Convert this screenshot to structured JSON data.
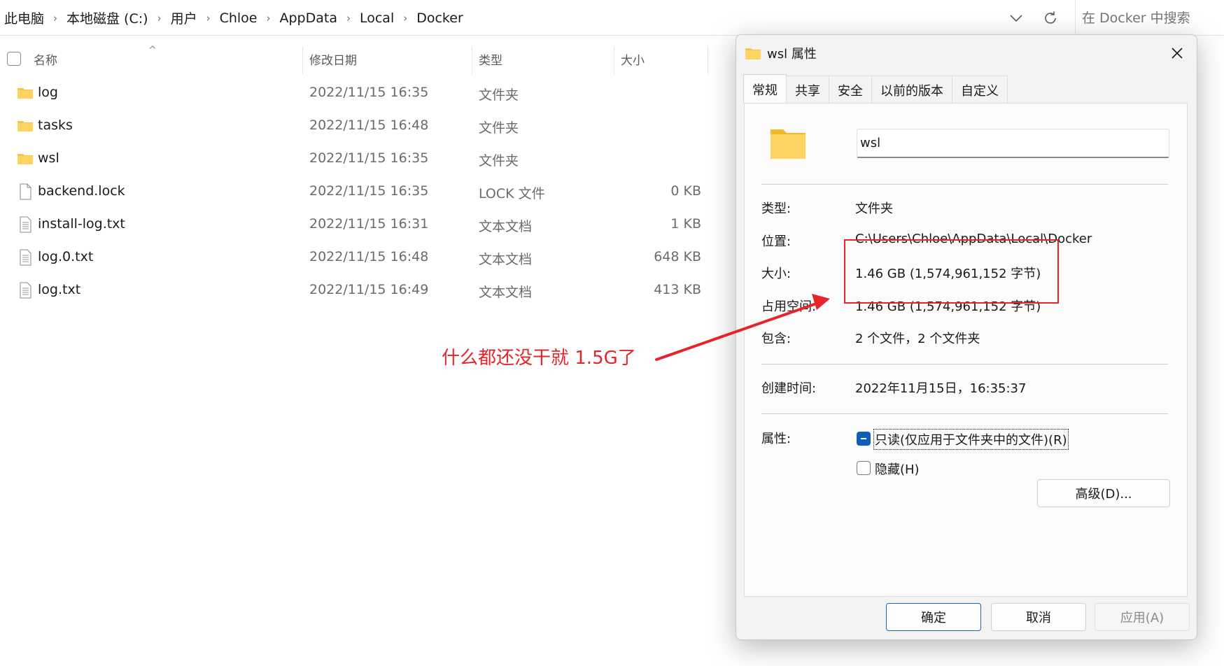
{
  "explorer": {
    "breadcrumb": [
      "此电脑",
      "本地磁盘 (C:)",
      "用户",
      "Chloe",
      "AppData",
      "Local",
      "Docker"
    ],
    "search_placeholder": "在 Docker 中搜索",
    "columns": {
      "name": "名称",
      "modified": "修改日期",
      "type": "类型",
      "size": "大小"
    },
    "files": [
      {
        "name": "log",
        "date": "2022/11/15 16:35",
        "type": "文件夹",
        "size": "",
        "icon": "folder-icon"
      },
      {
        "name": "tasks",
        "date": "2022/11/15 16:48",
        "type": "文件夹",
        "size": "",
        "icon": "folder-icon"
      },
      {
        "name": "wsl",
        "date": "2022/11/15 16:35",
        "type": "文件夹",
        "size": "",
        "icon": "folder-icon"
      },
      {
        "name": "backend.lock",
        "date": "2022/11/15 16:35",
        "type": "LOCK 文件",
        "size": "0 KB",
        "icon": "file-icon"
      },
      {
        "name": "install-log.txt",
        "date": "2022/11/15 16:31",
        "type": "文本文档",
        "size": "1 KB",
        "icon": "text-file-icon"
      },
      {
        "name": "log.0.txt",
        "date": "2022/11/15 16:48",
        "type": "文本文档",
        "size": "648 KB",
        "icon": "text-file-icon"
      },
      {
        "name": "log.txt",
        "date": "2022/11/15 16:49",
        "type": "文本文档",
        "size": "413 KB",
        "icon": "text-file-icon"
      }
    ]
  },
  "annotation": {
    "text": "什么都还没干就 1.5G了",
    "color": "#e6252b"
  },
  "dialog": {
    "title": "wsl 属性",
    "tabs": [
      "常规",
      "共享",
      "安全",
      "以前的版本",
      "自定义"
    ],
    "active_tab": "常规",
    "name_value": "wsl",
    "properties": {
      "type_label": "类型:",
      "type_value": "文件夹",
      "location_label": "位置:",
      "location_value": "C:\\Users\\Chloe\\AppData\\Local\\Docker",
      "size_label": "大小:",
      "size_value": "1.46 GB (1,574,961,152 字节)",
      "disk_size_label": "占用空间:",
      "disk_size_value": "1.46 GB (1,574,961,152 字节)",
      "contains_label": "包含:",
      "contains_value": "2 个文件，2 个文件夹",
      "created_label": "创建时间:",
      "created_value": "2022年11月15日，16:35:37",
      "attributes_label": "属性:"
    },
    "readonly_label": "只读(仅应用于文件夹中的文件)(R)",
    "hidden_label": "隐藏(H)",
    "advanced_button": "高级(D)...",
    "ok_button": "确定",
    "cancel_button": "取消",
    "apply_button": "应用(A)"
  }
}
